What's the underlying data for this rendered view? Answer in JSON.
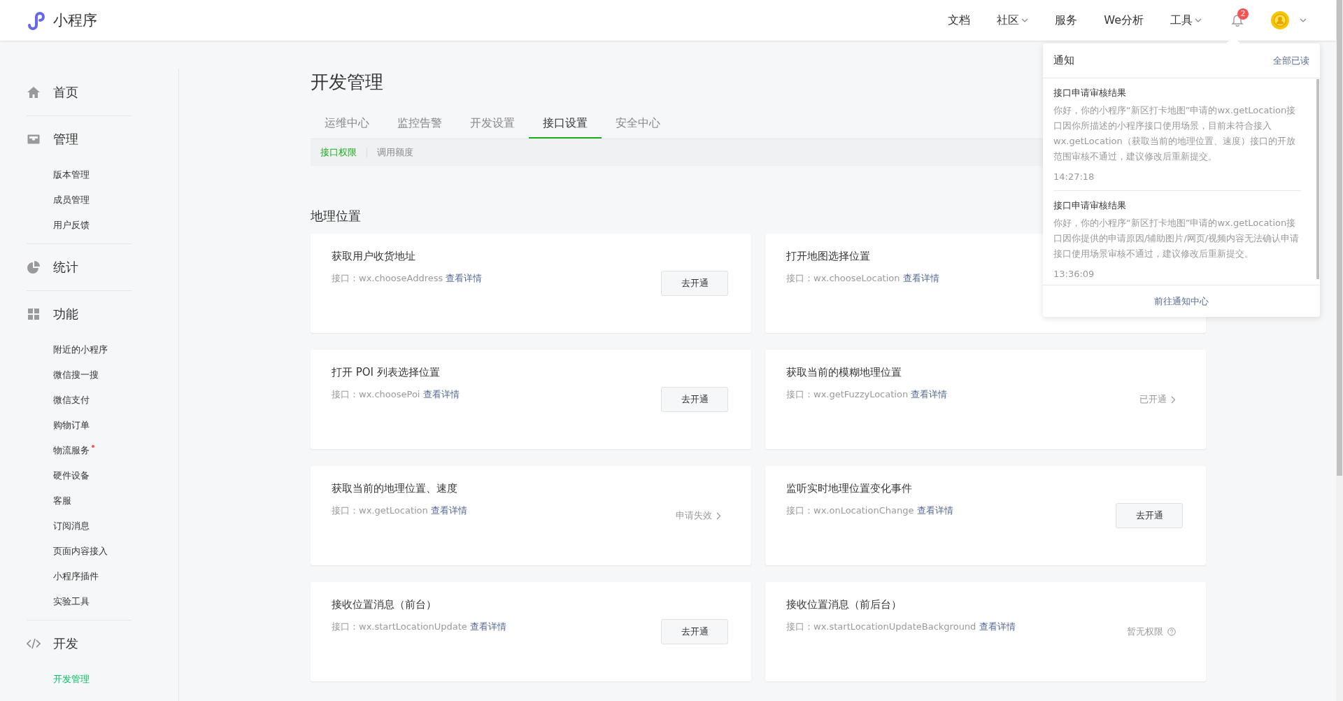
{
  "header": {
    "logo": "小程序",
    "nav": [
      {
        "label": "文档",
        "dropdown": false
      },
      {
        "label": "社区",
        "dropdown": true
      },
      {
        "label": "服务",
        "dropdown": false
      },
      {
        "label": "We分析",
        "dropdown": false
      },
      {
        "label": "工具",
        "dropdown": true
      }
    ],
    "badge": "2"
  },
  "sidebar": {
    "groups": [
      {
        "label": "首页"
      },
      {
        "label": "管理",
        "items": [
          {
            "label": "版本管理",
            "selected": false,
            "dot": false
          },
          {
            "label": "成员管理",
            "selected": false,
            "dot": false
          },
          {
            "label": "用户反馈",
            "selected": false,
            "dot": false
          }
        ]
      },
      {
        "label": "统计"
      },
      {
        "label": "功能",
        "items": [
          {
            "label": "附近的小程序",
            "selected": false,
            "dot": false
          },
          {
            "label": "微信搜一搜",
            "selected": false,
            "dot": false
          },
          {
            "label": "微信支付",
            "selected": false,
            "dot": false
          },
          {
            "label": "购物订单",
            "selected": false,
            "dot": false
          },
          {
            "label": "物流服务",
            "selected": false,
            "dot": true
          },
          {
            "label": "硬件设备",
            "selected": false,
            "dot": false
          },
          {
            "label": "客服",
            "selected": false,
            "dot": false
          },
          {
            "label": "订阅消息",
            "selected": false,
            "dot": false
          },
          {
            "label": "页面内容接入",
            "selected": false,
            "dot": false
          },
          {
            "label": "小程序插件",
            "selected": false,
            "dot": false
          },
          {
            "label": "实验工具",
            "selected": false,
            "dot": false
          }
        ]
      },
      {
        "label": "开发",
        "items": [
          {
            "label": "开发管理",
            "selected": true,
            "dot": false
          }
        ]
      }
    ]
  },
  "page": {
    "title": "开发管理",
    "tabs": [
      {
        "label": "运维中心",
        "selected": false
      },
      {
        "label": "监控告警",
        "selected": false
      },
      {
        "label": "开发设置",
        "selected": false
      },
      {
        "label": "接口设置",
        "selected": true
      },
      {
        "label": "安全中心",
        "selected": false
      }
    ],
    "subtabs": [
      {
        "label": "接口权限",
        "selected": true
      },
      {
        "label": "调用额度",
        "selected": false
      }
    ],
    "section": "地理位置",
    "cards": [
      {
        "title": "获取用户收货地址",
        "api": "接口：wx.chooseAddress",
        "link": "查看详情",
        "action": {
          "kind": "button",
          "label": "去开通"
        }
      },
      {
        "title": "打开地图选择位置",
        "api": "接口：wx.chooseLocation",
        "link": "查看详情"
      },
      {
        "title": "打开 POI 列表选择位置",
        "api": "接口：wx.choosePoi",
        "link": "查看详情",
        "action": {
          "kind": "button",
          "label": "去开通"
        }
      },
      {
        "title": "获取当前的模糊地理位置",
        "api": "接口：wx.getFuzzyLocation",
        "link": "查看详情",
        "action": {
          "kind": "status",
          "label": "已开通"
        }
      },
      {
        "title": "获取当前的地理位置、速度",
        "api": "接口：wx.getLocation",
        "link": "查看详情",
        "action": {
          "kind": "status",
          "label": "申请失效"
        }
      },
      {
        "title": "监听实时地理位置变化事件",
        "api": "接口：wx.onLocationChange",
        "link": "查看详情",
        "action": {
          "kind": "button",
          "label": "去开通"
        }
      },
      {
        "title": "接收位置消息（前台）",
        "api": "接口：wx.startLocationUpdate",
        "link": "查看详情",
        "action": {
          "kind": "button",
          "label": "去开通"
        }
      },
      {
        "title": "接收位置消息（前后台）",
        "api": "接口：wx.startLocationUpdateBackground",
        "link": "查看详情",
        "action": {
          "kind": "help",
          "label": "暂无权限"
        }
      }
    ]
  },
  "notifications": {
    "title": "通知",
    "mark_all": "全部已读",
    "items": [
      {
        "title": "接口申请审核结果",
        "body": "你好，你的小程序“新区打卡地图”申请的wx.getLocation接口因你所描述的小程序接口使用场景，目前未符合接入wx.getLocation（获取当前的地理位置、速度）接口的开放范围审核不通过，建议修改后重新提交。",
        "time": "14:27:18"
      },
      {
        "title": "接口申请审核结果",
        "body": "你好，你的小程序“新区打卡地图”申请的wx.getLocation接口因你提供的申请原因/辅助图片/网页/视频内容无法确认申请接口使用场景审核不通过，建议修改后重新提交。",
        "time": "13:36:09"
      }
    ],
    "footer": "前往通知中心"
  }
}
